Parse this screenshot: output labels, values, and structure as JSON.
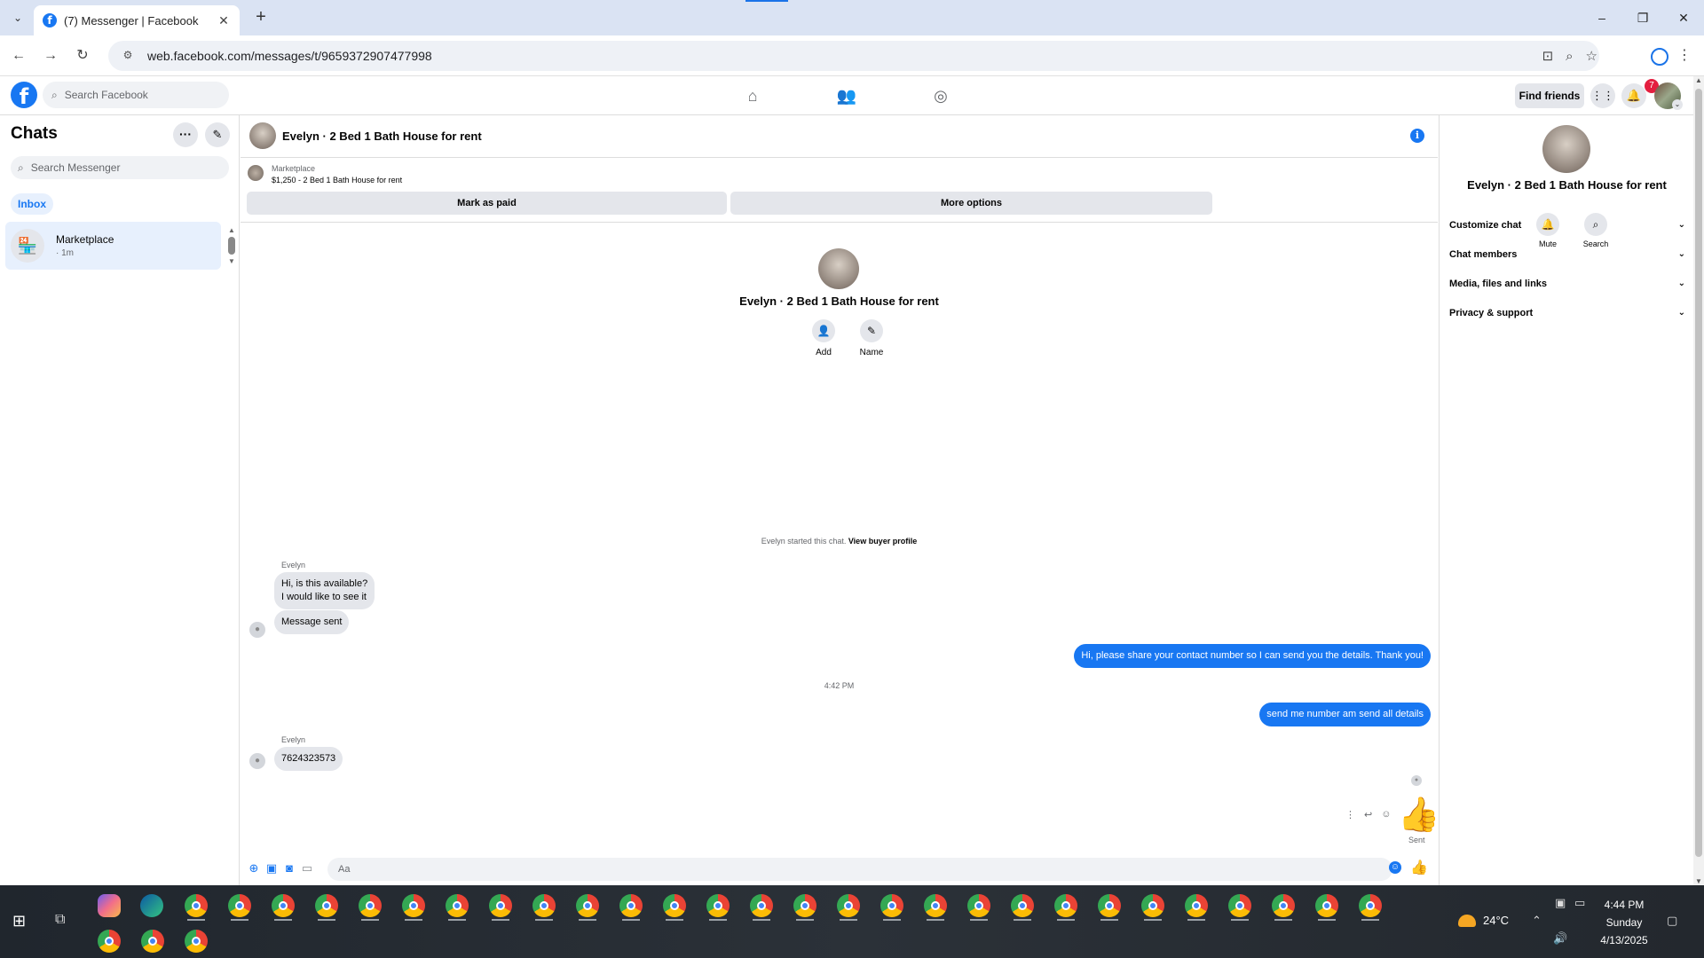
{
  "browser": {
    "tab_title": "(7) Messenger | Facebook",
    "tab_close": "✕",
    "new_tab": "+",
    "url": "web.facebook.com/messages/t/9659372907477998",
    "window_min": "–",
    "window_restore": "❐",
    "window_close": "✕"
  },
  "fb_header": {
    "search_placeholder": "Search Facebook",
    "find_friends": "Find friends",
    "notification_count": "7"
  },
  "chats": {
    "title": "Chats",
    "more": "···",
    "search_placeholder": "Search Messenger",
    "inbox": "Inbox",
    "items": [
      {
        "name": "Marketplace",
        "time": "· 1m"
      }
    ]
  },
  "conversation": {
    "title": "Evelyn · 2 Bed 1 Bath House for rent",
    "listing_label": "Marketplace",
    "listing_price": "$1,250 - 2 Bed 1 Bath House for rent",
    "mark_as_paid": "Mark as paid",
    "more_options": "More options",
    "add_label": "Add",
    "name_label": "Name",
    "started_text": "Evelyn started this chat.",
    "view_buyer_profile": "View buyer profile",
    "sender_name": "Evelyn",
    "msg_in_1_line1": "Hi, is this available?",
    "msg_in_1_line2": "I would like to see it",
    "msg_in_2": "Message sent",
    "msg_out_1": "Hi, please share your contact number so I can send you the details. Thank you!",
    "timestamp": "4:42 PM",
    "msg_out_2": "send me number am send all details",
    "sender_name_2": "Evelyn",
    "msg_in_3": "7624323573",
    "sent_label": "Sent",
    "composer_placeholder": "Aa"
  },
  "info_panel": {
    "name": "Evelyn · 2 Bed 1 Bath House for rent",
    "mute": "Mute",
    "search": "Search",
    "rows": [
      "Customize chat",
      "Chat members",
      "Media, files and links",
      "Privacy & support"
    ]
  },
  "taskbar": {
    "temperature": "24°C",
    "time": "4:44 PM",
    "day": "Sunday",
    "date": "4/13/2025"
  },
  "colors": {
    "accent": "#1877f2",
    "bubble_in": "#e4e6eb",
    "notification": "#e41e3f"
  }
}
